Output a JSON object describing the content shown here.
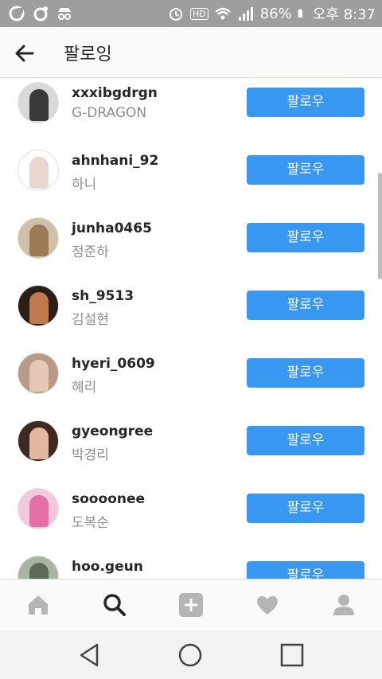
{
  "status_bar": {
    "battery": "86%",
    "time": "오후 8:37",
    "hd_label": "HD"
  },
  "header": {
    "title": "팔로잉"
  },
  "following": [
    {
      "username": "xxxibgdrgn",
      "fullname": "G-DRAGON",
      "button": "팔로우",
      "avatar_color": "#3a3a3a"
    },
    {
      "username": "ahnhani_92",
      "fullname": "하니",
      "button": "팔로우",
      "avatar_color": "#e8d7cf"
    },
    {
      "username": "junha0465",
      "fullname": "정준하",
      "button": "팔로우",
      "avatar_color": "#9a7b55"
    },
    {
      "username": "sh_9513",
      "fullname": "김설현",
      "button": "팔로우",
      "avatar_color": "#5a3a2a"
    },
    {
      "username": "hyeri_0609",
      "fullname": "혜리",
      "button": "팔로우",
      "avatar_color": "#c8a590"
    },
    {
      "username": "gyeongree",
      "fullname": "박경리",
      "button": "팔로우",
      "avatar_color": "#6b4a3e"
    },
    {
      "username": "soooonee",
      "fullname": "도복순",
      "button": "팔로우",
      "avatar_color": "#e46fa5"
    },
    {
      "username": "hoo.geun",
      "fullname": "",
      "button": "팔로우",
      "avatar_color": "#7f8f7a"
    }
  ],
  "bottom_nav": [
    "home-icon",
    "search-icon",
    "add-post-icon",
    "heart-icon",
    "profile-icon"
  ],
  "colors": {
    "accent": "#3897f0",
    "active_nav": "#262626",
    "inactive_nav": "#b5b5b5"
  }
}
